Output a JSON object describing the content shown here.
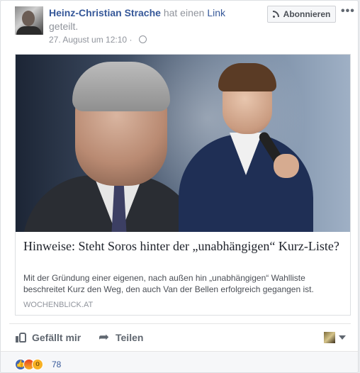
{
  "post": {
    "author": "Heinz-Christian Strache",
    "verb": "hat einen",
    "link_word": "Link",
    "verb_end": "geteilt.",
    "timestamp": "27. August um 12:10",
    "privacy_icon": "globe-icon",
    "subscribe_label": "Abonnieren",
    "more_icon": "•••"
  },
  "link": {
    "title": "Hinweise: Steht Soros hinter der „unabhängigen“ Kurz-Liste?",
    "description": "Mit der Gründung einer eigenen, nach außen hin „unabhängigen“ Wahlliste beschreitet Kurz den Weg, den auch Van der Bellen erfolgreich gegangen ist.",
    "domain": "WOCHENBLICK.AT"
  },
  "actions": {
    "like_label": "Gefällt mir",
    "share_label": "Teilen"
  },
  "reactions": {
    "icons": [
      "like-icon",
      "angry-icon",
      "wow-icon"
    ],
    "count": "78"
  },
  "colors": {
    "link_blue": "#365899",
    "meta_gray": "#90949c",
    "bg": "#e9ebee"
  }
}
